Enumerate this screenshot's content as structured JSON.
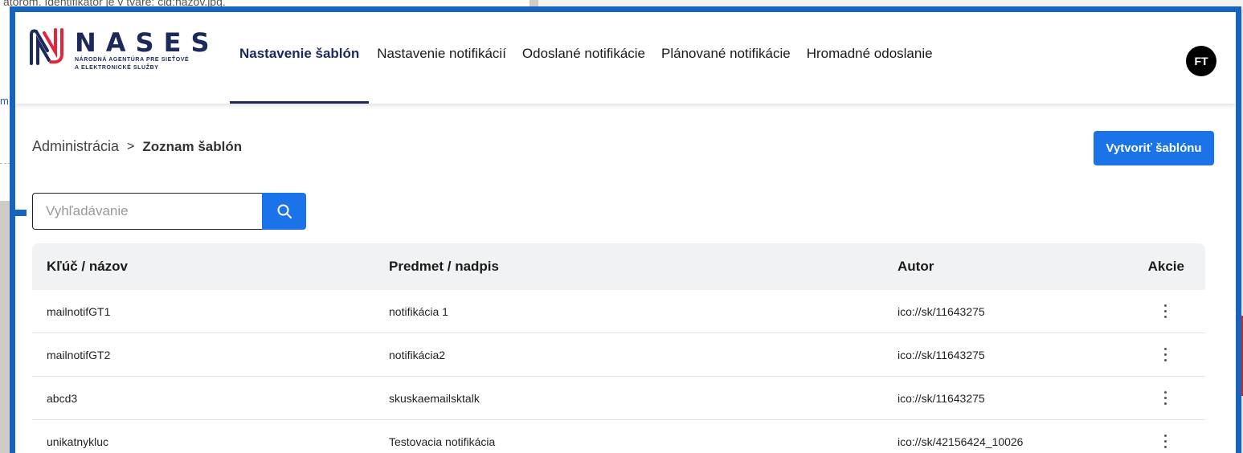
{
  "background": {
    "partial_text": "atorom. Identifikátor je v tvare: cid:názov.jpg.",
    "partial_link": "m"
  },
  "brand": {
    "name": "NASES",
    "subtitle_line1": "NÁRODNÁ AGENTÚRA PRE SIEŤOVÉ",
    "subtitle_line2": "A ELEKTRONICKÉ SLUŽBY"
  },
  "nav": {
    "items": [
      {
        "label": "Nastavenie šablón",
        "active": true
      },
      {
        "label": "Nastavenie notifikácií",
        "active": false
      },
      {
        "label": "Odoslané notifikácie",
        "active": false
      },
      {
        "label": "Plánované notifikácie",
        "active": false
      },
      {
        "label": "Hromadné odoslanie",
        "active": false
      }
    ]
  },
  "user": {
    "initials": "FT"
  },
  "breadcrumb": {
    "root": "Administrácia",
    "separator": ">",
    "current": "Zoznam šablón"
  },
  "toolbar": {
    "create_label": "Vytvoriť šablónu"
  },
  "search": {
    "placeholder": "Vyhľadávanie",
    "value": "",
    "icon": "search-icon"
  },
  "table": {
    "headers": {
      "key": "Kľúč / názov",
      "subject": "Predmet / nadpis",
      "author": "Autor",
      "actions": "Akcie"
    },
    "rows": [
      {
        "key": "mailnotifGT1",
        "subject": "notifikácia 1",
        "author": "ico://sk/11643275"
      },
      {
        "key": "mailnotifGT2",
        "subject": "notifikácia2",
        "author": "ico://sk/11643275"
      },
      {
        "key": "abcd3",
        "subject": "skuskaemailsktalk",
        "author": "ico://sk/11643275"
      },
      {
        "key": "unikatnykluc",
        "subject": "Testovacia notifikácia",
        "author": "ico://sk/42156424_10026"
      }
    ]
  },
  "colors": {
    "frame": "#1565c0",
    "primary": "#1a73e8",
    "brand_navy": "#1b2a5a",
    "brand_red": "#e4263a"
  }
}
